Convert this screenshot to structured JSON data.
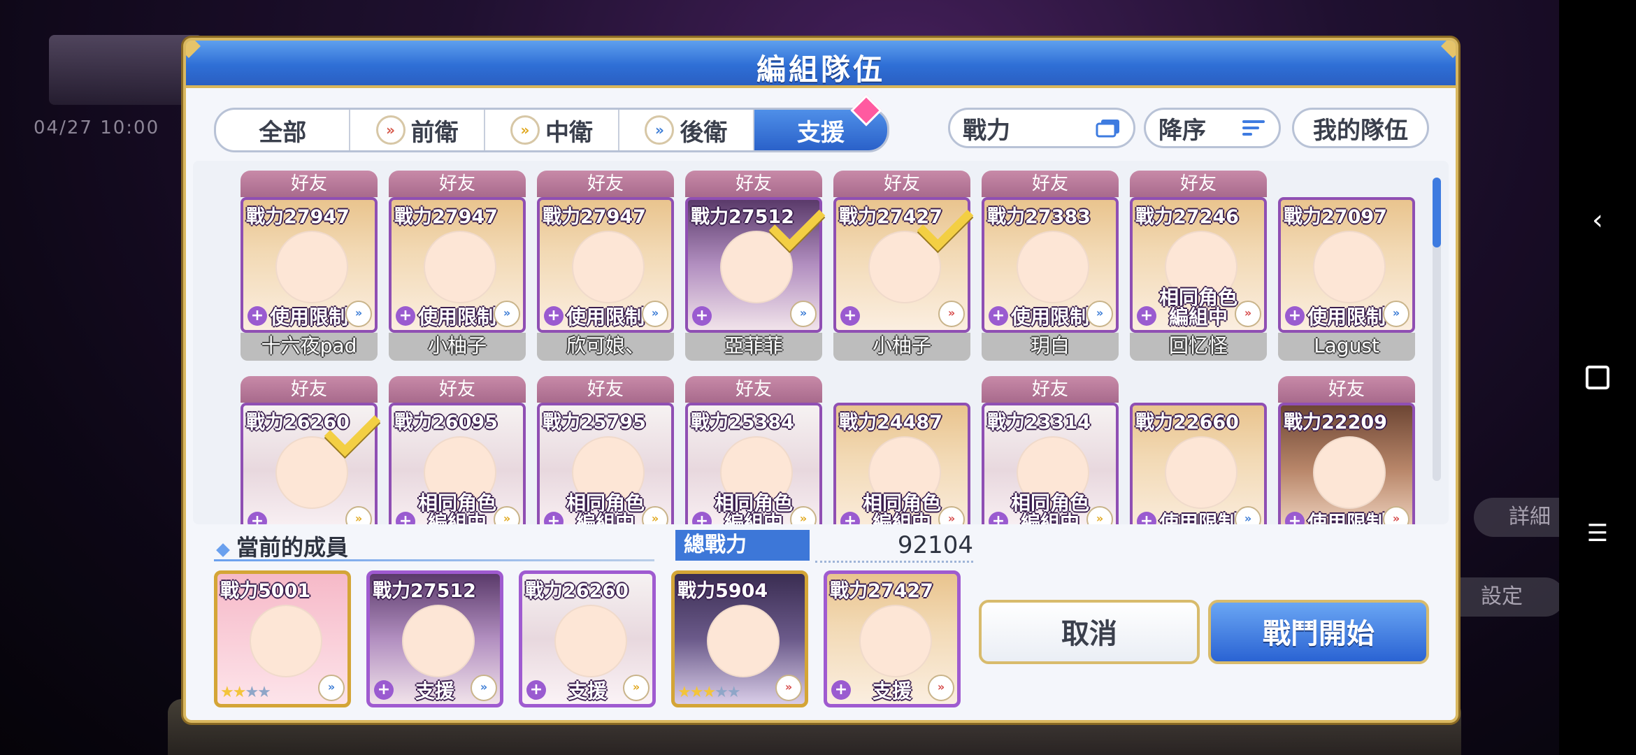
{
  "background": {
    "date_text": "04/27 10:00",
    "right_button_1": "詳細",
    "right_button_2": "設定"
  },
  "dialog": {
    "title": "編組隊伍"
  },
  "tabs": [
    {
      "label": "全部",
      "icon": ""
    },
    {
      "label": "前衛",
      "icon": "front-role-icon"
    },
    {
      "label": "中衛",
      "icon": "middle-role-icon"
    },
    {
      "label": "後衛",
      "icon": "back-role-icon"
    },
    {
      "label": "支援",
      "icon": "",
      "active": true
    }
  ],
  "sort": {
    "power_label": "戰力",
    "order_label": "降序",
    "my_team_label": "我的隊伍"
  },
  "friend_label": "好友",
  "cards_row1": [
    {
      "power": "戰力27947",
      "status": "使用限制",
      "name": "十六夜pad",
      "friend": true,
      "checked": false,
      "bg": "gold",
      "chev": "#3b7cd6"
    },
    {
      "power": "戰力27947",
      "status": "使用限制",
      "name": "小柚子",
      "friend": true,
      "checked": false,
      "bg": "gold",
      "chev": "#3b7cd6"
    },
    {
      "power": "戰力27947",
      "status": "使用限制",
      "name": "欣可娘、",
      "friend": true,
      "checked": false,
      "bg": "gold",
      "chev": "#3b7cd6"
    },
    {
      "power": "戰力27512",
      "status": "",
      "name": "亞菲菲",
      "friend": true,
      "checked": true,
      "bg": "purple",
      "chev": "#3b7cd6"
    },
    {
      "power": "戰力27427",
      "status": "",
      "name": "小柚子",
      "friend": true,
      "checked": true,
      "bg": "gold",
      "chev": "#d64a4a"
    },
    {
      "power": "戰力27383",
      "status": "使用限制",
      "name": "玥白",
      "friend": true,
      "checked": false,
      "bg": "gold",
      "chev": "#3b7cd6"
    },
    {
      "power": "戰力27246",
      "status": "相同角色\n編組中",
      "name": "回忆怪",
      "friend": true,
      "checked": false,
      "bg": "gold",
      "chev": "#d64a4a"
    },
    {
      "power": "戰力27097",
      "status": "使用限制",
      "name": "Lagust",
      "friend": false,
      "checked": false,
      "bg": "gold",
      "chev": "#3b7cd6"
    }
  ],
  "cards_row2": [
    {
      "power": "戰力26260",
      "status": "",
      "friend": true,
      "checked": true,
      "bg": "white",
      "chev": "#e0a820"
    },
    {
      "power": "戰力26095",
      "status": "相同角色\n編組中",
      "friend": true,
      "checked": false,
      "bg": "white",
      "chev": "#e0a820"
    },
    {
      "power": "戰力25795",
      "status": "相同角色\n編組中",
      "friend": true,
      "checked": false,
      "bg": "white",
      "chev": "#e0a820"
    },
    {
      "power": "戰力25384",
      "status": "相同角色\n編組中",
      "friend": true,
      "checked": false,
      "bg": "white",
      "chev": "#e0a820"
    },
    {
      "power": "戰力24487",
      "status": "相同角色\n編組中",
      "friend": false,
      "checked": false,
      "bg": "gold",
      "chev": "#d64a4a"
    },
    {
      "power": "戰力23314",
      "status": "相同角色\n編組中",
      "friend": true,
      "checked": false,
      "bg": "white",
      "chev": "#e0a820"
    },
    {
      "power": "戰力22660",
      "status": "使用限制",
      "friend": false,
      "checked": false,
      "bg": "gold",
      "chev": "#3b7cd6"
    },
    {
      "power": "戰力22209",
      "status": "使用限制",
      "friend": true,
      "checked": false,
      "bg": "brown",
      "chev": "#d64a4a"
    }
  ],
  "members": {
    "title": "當前的成員",
    "total_label": "總戰力",
    "total_value": "92104",
    "list": [
      {
        "power": "戰力5001",
        "tag": "",
        "stars": 2,
        "max_stars": 4,
        "border": "gold",
        "bg": "pink",
        "chev": "#3b7cd6"
      },
      {
        "power": "戰力27512",
        "tag": "支援",
        "stars": 0,
        "border": "purple",
        "bg": "purple",
        "chev": "#3b7cd6"
      },
      {
        "power": "戰力26260",
        "tag": "支援",
        "stars": 0,
        "border": "purple",
        "bg": "white",
        "chev": "#e0a820"
      },
      {
        "power": "戰力5904",
        "tag": "",
        "stars": 3,
        "max_stars": 5,
        "border": "gold",
        "bg": "dark",
        "chev": "#d64a4a"
      },
      {
        "power": "戰力27427",
        "tag": "支援",
        "stars": 0,
        "border": "purple",
        "bg": "gold",
        "chev": "#d64a4a"
      }
    ]
  },
  "buttons": {
    "cancel": "取消",
    "start": "戰鬥開始"
  }
}
